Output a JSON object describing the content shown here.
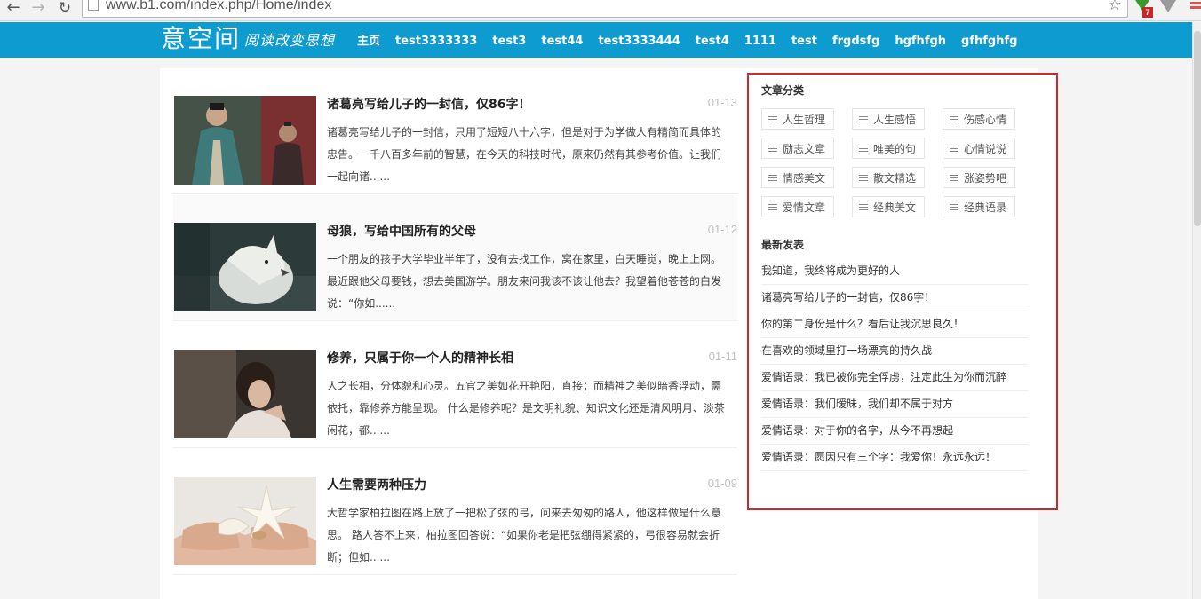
{
  "browser": {
    "url": "www.b1.com/index.php/Home/index",
    "extension_badge": "7"
  },
  "site": {
    "logo": "意空间",
    "slogan": "阅读改变思想"
  },
  "nav": [
    "主页",
    "test3333333",
    "test3",
    "test44",
    "test3333444",
    "test4",
    "1111",
    "test",
    "frgdsfg",
    "hgfhfgh",
    "gfhfghfg"
  ],
  "articles": [
    {
      "title": "诸葛亮写给儿子的一封信，仅86字！",
      "date": "01-13",
      "excerpt": "诸葛亮写给儿子的一封信，只用了短短八十六字，但是对于为学做人有精简而具体的忠告。一千八百多年前的智慧，在今天的科技时代，原来仍然有其参考价值。让我们一起向诸......"
    },
    {
      "title": "母狼，写给中国所有的父母",
      "date": "01-12",
      "excerpt": "一个朋友的孩子大学毕业半年了，没有去找工作，窝在家里，白天睡觉，晚上上网。最近跟他父母要钱，想去美国游学。朋友来问我该不该让他去？我望着他苍苍的白发说：“你如......"
    },
    {
      "title": "修养，只属于你一个人的精神长相",
      "date": "01-11",
      "excerpt": "人之长相，分体貌和心灵。五官之美如花开艳阳，直接；而精神之美似暗香浮动，需依托，靠修养方能呈现。 什么是修养呢？是文明礼貌、知识文化还是清风明月、淡茶闲花，都......"
    },
    {
      "title": "人生需要两种压力",
      "date": "01-09",
      "excerpt": "大哲学家柏拉图在路上放了一把松了弦的弓，问来去匆匆的路人，他这样做是什么意思。 路人答不上来，柏拉图回答说：“如果你老是把弦绷得紧紧的，弓很容易就会折断；但如......"
    }
  ],
  "sidebar": {
    "categories_heading": "文章分类",
    "categories": [
      "人生哲理",
      "人生感悟",
      "伤感心情",
      "励志文章",
      "唯美的句",
      "心情说说",
      "情感美文",
      "散文精选",
      "涨姿势吧",
      "爱情文章",
      "经典美文",
      "经典语录"
    ],
    "latest_heading": "最新发表",
    "latest": [
      "我知道，我终将成为更好的人",
      "诸葛亮写给儿子的一封信，仅86字！",
      "你的第二身份是什么？看后让我沉思良久！",
      "在喜欢的领域里打一场漂亮的持久战",
      "爱情语录：我已被你完全俘虏，注定此生为你而沉醉",
      "爱情语录：我们暧昧，我们却不属于对方",
      "爱情语录：对于你的名字，从今不再想起",
      "爱情语录：愿因只有三个字：我爱你！永远永远！"
    ]
  },
  "colors": {
    "header_bg": "#0e9bd0",
    "highlight_border": "#cc2a2a"
  }
}
